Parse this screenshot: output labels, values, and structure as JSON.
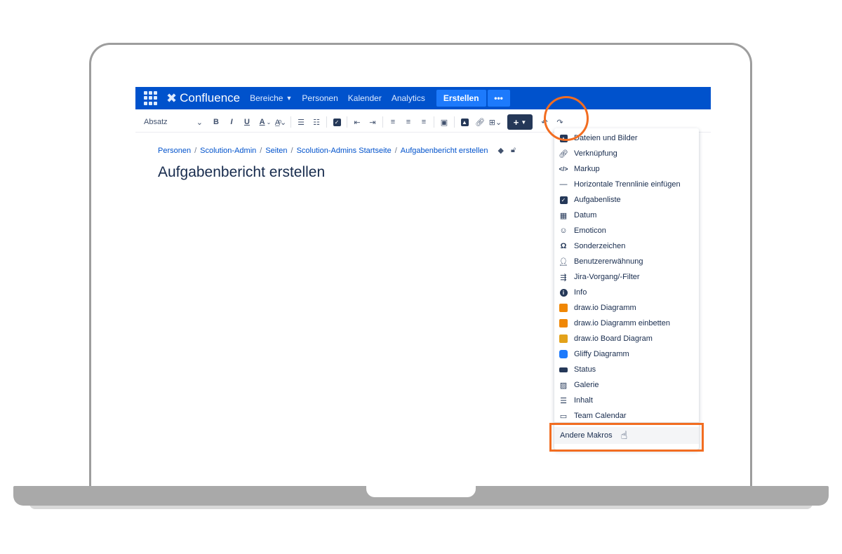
{
  "topnav": {
    "logo": "Confluence",
    "links": [
      {
        "label": "Bereiche",
        "has_chevron": true
      },
      {
        "label": "Personen"
      },
      {
        "label": "Kalender"
      },
      {
        "label": "Analytics"
      }
    ],
    "create_label": "Erstellen",
    "more_label": "•••"
  },
  "toolbar": {
    "paragraph_style": "Absatz",
    "bold": "B",
    "italic": "I",
    "underline": "U",
    "text_color": "A",
    "insert_label": "+"
  },
  "breadcrumb": [
    "Personen",
    "Scolution-Admin",
    "Seiten",
    "Scolution-Admins Startseite",
    "Aufgabenbericht erstellen"
  ],
  "page": {
    "title": "Aufgabenbericht erstellen"
  },
  "menu": {
    "items": [
      {
        "label": "Dateien und Bilder",
        "icon": "image-icon"
      },
      {
        "label": "Verknüpfung",
        "icon": "link-icon"
      },
      {
        "label": "Markup",
        "icon": "code-icon"
      },
      {
        "label": "Horizontale Trennlinie einfügen",
        "icon": "horizontal-rule-icon"
      },
      {
        "label": "Aufgabenliste",
        "icon": "task-checkbox-icon"
      },
      {
        "label": "Datum",
        "icon": "calendar-icon"
      },
      {
        "label": "Emoticon",
        "icon": "emoticon-icon"
      },
      {
        "label": "Sonderzeichen",
        "icon": "omega-icon"
      },
      {
        "label": "Benutzererwähnung",
        "icon": "user-mention-icon"
      },
      {
        "label": "Jira-Vorgang/-Filter",
        "icon": "jira-icon"
      },
      {
        "label": "Info",
        "icon": "info-icon"
      },
      {
        "label": "draw.io Diagramm",
        "icon": "drawio-icon"
      },
      {
        "label": "draw.io Diagramm einbetten",
        "icon": "drawio-embed-icon"
      },
      {
        "label": "draw.io Board Diagram",
        "icon": "drawio-board-icon"
      },
      {
        "label": "Gliffy Diagramm",
        "icon": "gliffy-icon"
      },
      {
        "label": "Status",
        "icon": "status-icon"
      },
      {
        "label": "Galerie",
        "icon": "gallery-icon"
      },
      {
        "label": "Inhalt",
        "icon": "toc-icon"
      },
      {
        "label": "Team Calendar",
        "icon": "team-calendar-icon"
      }
    ],
    "other_macros": "Andere Makros"
  },
  "colors": {
    "nav": "#0052cc",
    "create": "#1d7afc",
    "accent_annotation": "#f26d21"
  }
}
